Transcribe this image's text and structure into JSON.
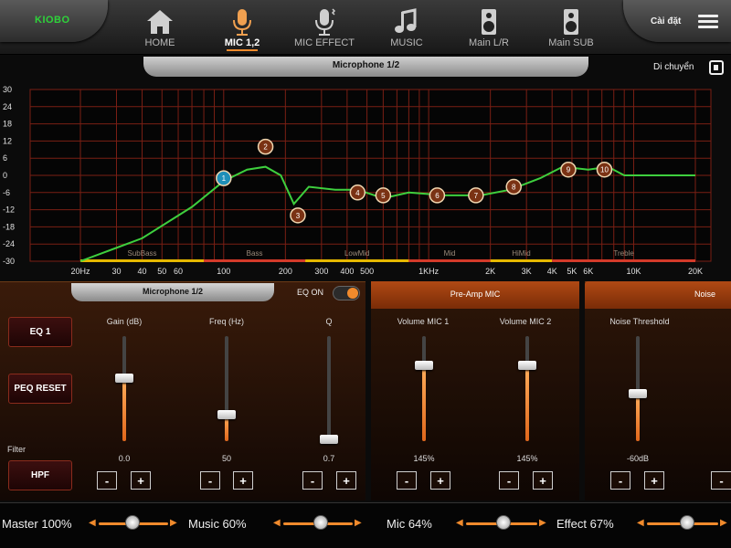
{
  "header": {
    "logo_text": "KIOBO",
    "settings_label": "Cài đặt",
    "nav": [
      {
        "label": "HOME",
        "icon": "home-icon",
        "active": false
      },
      {
        "label": "MIC 1,2",
        "icon": "microphone-icon",
        "active": true
      },
      {
        "label": "MIC EFFECT",
        "icon": "mic-effect-icon",
        "active": false
      },
      {
        "label": "MUSIC",
        "icon": "music-note-icon",
        "active": false
      },
      {
        "label": "Main L/R",
        "icon": "speaker-icon",
        "active": false
      },
      {
        "label": "Main SUB",
        "icon": "subwoofer-icon",
        "active": false
      }
    ]
  },
  "graph": {
    "title": "Microphone 1/2",
    "move_label": "Di chuyển",
    "y_ticks": [
      "30",
      "24",
      "18",
      "12",
      "6",
      "0",
      "-6",
      "-12",
      "-18",
      "-24",
      "-30"
    ],
    "x_ticks": [
      "20Hz",
      "30",
      "40",
      "50",
      "60",
      "100",
      "200",
      "300",
      "400",
      "500",
      "1KHz",
      "2K",
      "3K",
      "4K",
      "5K",
      "6K",
      "10K",
      "20K"
    ],
    "bands": [
      "SubBass",
      "Bass",
      "LowMid",
      "Mid",
      "HiMid",
      "Treble"
    ],
    "band_colors": [
      "#e6b800",
      "#d43a2a",
      "#e6b800",
      "#d43a2a",
      "#e6b800",
      "#d43a2a"
    ],
    "grid_color": "#7a1f14",
    "curve_color": "#3ecf3e",
    "points": [
      {
        "label": "1",
        "selected": true
      },
      {
        "label": "2",
        "selected": false
      },
      {
        "label": "3",
        "selected": false
      },
      {
        "label": "4",
        "selected": false
      },
      {
        "label": "5",
        "selected": false
      },
      {
        "label": "6",
        "selected": false
      },
      {
        "label": "7",
        "selected": false
      },
      {
        "label": "8",
        "selected": false
      },
      {
        "label": "9",
        "selected": false
      },
      {
        "label": "10",
        "selected": false
      }
    ]
  },
  "eq_panel": {
    "title": "Microphone 1/2",
    "eq_on_label": "EQ ON",
    "eq_on": true,
    "eq_button": "EQ 1",
    "reset_button": "PEQ RESET",
    "filter_label": "Filter",
    "filter_button": "HPF",
    "sliders": [
      {
        "label": "Gain (dB)",
        "value": "0.0",
        "level": 0.6
      },
      {
        "label": "Freq (Hz)",
        "value": "50",
        "level": 0.25
      },
      {
        "label": "Q",
        "value": "0.7",
        "level": 0.02
      }
    ]
  },
  "preamp_panel": {
    "title": "Pre-Amp MIC",
    "sliders": [
      {
        "label": "Volume MIC 1",
        "value": "145%",
        "level": 0.72
      },
      {
        "label": "Volume MIC 2",
        "value": "145%",
        "level": 0.72
      }
    ]
  },
  "noise_panel": {
    "title": "Noise",
    "sliders": [
      {
        "label": "Noise Threshold",
        "value": "-60dB",
        "level": 0.45
      }
    ]
  },
  "master_bar": {
    "items": [
      {
        "label": "Master 100%",
        "level": 0.35
      },
      {
        "label": "Music 60%",
        "level": 0.6
      },
      {
        "label": "Mic 64%",
        "level": 0.64
      },
      {
        "label": "Effect 67%",
        "level": 0.67
      }
    ]
  },
  "accent_color": "#f08a2c"
}
